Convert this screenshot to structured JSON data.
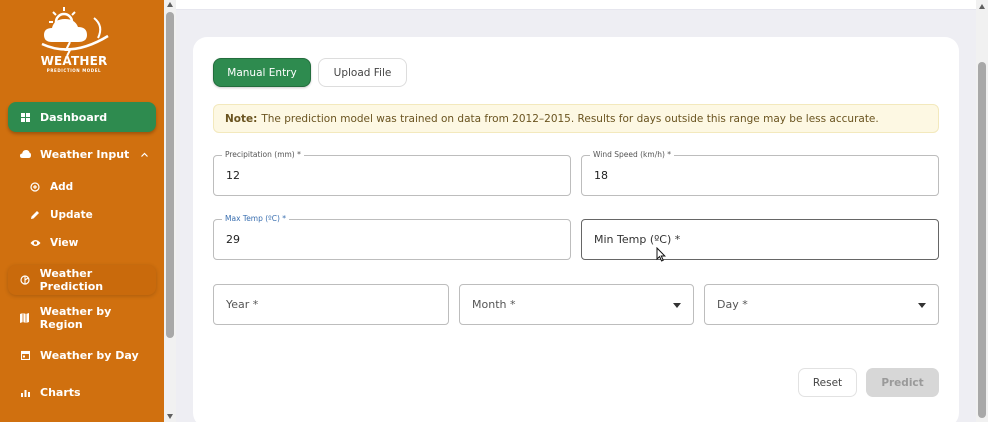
{
  "logo": {
    "title": "WEATHER",
    "subtitle": "PREDICTION MODEL"
  },
  "sidebar": {
    "items": [
      {
        "label": "Dashboard",
        "icon": "grid-icon"
      },
      {
        "label": "Weather Input",
        "icon": "cloud-icon"
      },
      {
        "label": "Add",
        "icon": "plus-circle-icon"
      },
      {
        "label": "Update",
        "icon": "pencil-icon"
      },
      {
        "label": "View",
        "icon": "eye-icon"
      },
      {
        "label": "Weather Prediction",
        "icon": "sun-cloud-icon"
      },
      {
        "label": "Weather by Region",
        "icon": "map-icon"
      },
      {
        "label": "Weather by Day",
        "icon": "calendar-icon"
      },
      {
        "label": "Charts",
        "icon": "bar-chart-icon"
      }
    ]
  },
  "tabs": {
    "manual": "Manual Entry",
    "upload": "Upload File"
  },
  "note": {
    "label": "Note:",
    "text": "The prediction model was trained on data from 2012–2015. Results for days outside this range may be less accurate."
  },
  "form": {
    "precipitation": {
      "label": "Precipitation (mm) *",
      "value": "12"
    },
    "wind_speed": {
      "label": "Wind Speed (km/h) *",
      "value": "18"
    },
    "max_temp": {
      "label": "Max Temp (ºC) *",
      "value": "29"
    },
    "min_temp": {
      "placeholder": "Min Temp (ºC) *"
    },
    "year": {
      "placeholder": "Year *"
    },
    "month": {
      "placeholder": "Month *"
    },
    "day": {
      "placeholder": "Day *"
    }
  },
  "actions": {
    "reset": "Reset",
    "predict": "Predict"
  },
  "colors": {
    "sidebar": "#d0700f",
    "accent_green": "#2e8b4f",
    "note_bg": "#fdf8e3"
  }
}
